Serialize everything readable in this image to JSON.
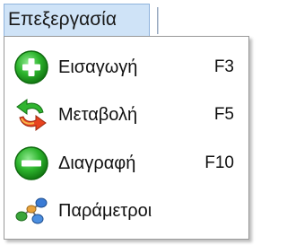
{
  "menubar": {
    "menu_title": "Επεξεργασία"
  },
  "menu": {
    "items": [
      {
        "label": "Εισαγωγή",
        "shortcut": "F3",
        "icon": "add-icon",
        "color": "#2db52d"
      },
      {
        "label": "Μεταβολή",
        "shortcut": "F5",
        "icon": "refresh-arrows-icon",
        "color": "#e0331b"
      },
      {
        "label": "Διαγραφή",
        "shortcut": "F10",
        "icon": "remove-icon",
        "color": "#2db52d"
      },
      {
        "label": "Παράμετροι",
        "shortcut": "",
        "icon": "network-nodes-icon",
        "color": "#3a7bd5"
      }
    ]
  },
  "colors": {
    "menu_highlight": "#cfe3f7",
    "menu_border": "#9a9a9a",
    "green_icon": "#2db52d",
    "red_arrow": "#e0331b"
  }
}
